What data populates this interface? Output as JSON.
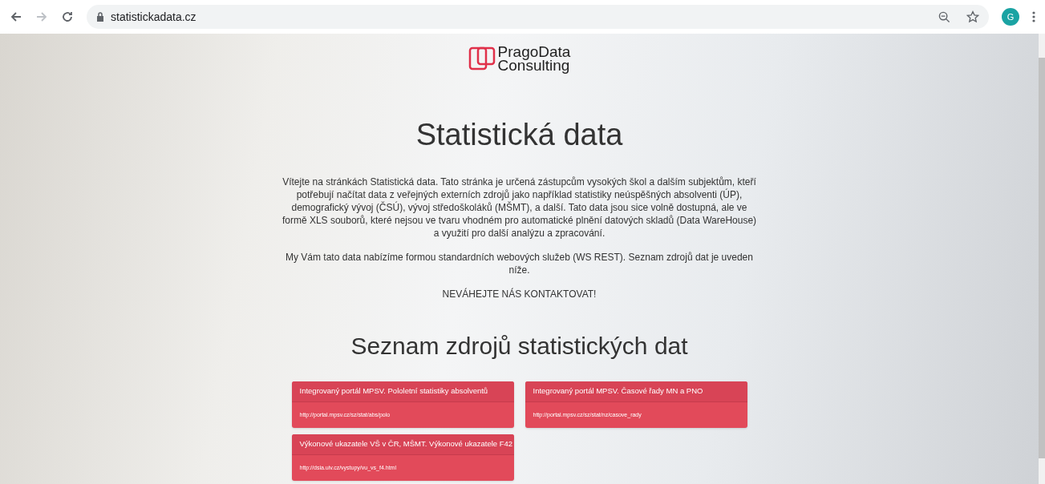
{
  "browser": {
    "url": "statistickadata.cz",
    "profile_initial": "G"
  },
  "logo": {
    "line1": "PragoData",
    "line2": "Consulting"
  },
  "title": "Statistická data",
  "paragraphs": [
    "Vítejte na stránkách Statistická data. Tato stránka je určená zástupcům vysokých škol a dalším subjektům, kteří potřebují načítat data z veřejných externích zdrojů jako například statistiky neúspěšných absolventi (ÚP), demografický vývoj (ČSÚ), vývoj středoškoláků (MŠMT), a další. Tato data jsou sice volně dostupná, ale ve formě XLS souborů, které nejsou ve tvaru vhodném pro automatické plnění datových skladů (Data WareHouse) a využití pro další analýzu a zpracování.",
    "My Vám tato data nabízíme formou standardních webových služeb (WS REST). Seznam zdrojů dat je uveden níže.",
    "NEVÁHEJTE NÁS KONTAKTOVAT!"
  ],
  "sources_heading": "Seznam zdrojů statistických dat",
  "sources": [
    {
      "title": "Integrovaný portál MPSV. Pololetní statistiky absolventů",
      "url": "http://portal.mpsv.cz/sz/stat/abs/polo"
    },
    {
      "title": "Integrovaný portál MPSV. Časové řady MN a PNO",
      "url": "http://portal.mpsv.cz/sz/stat/nz/casove_rady"
    },
    {
      "title": "Výkonové ukazatele VŠ v ČR, MŠMT. Výkonové ukazatele F42",
      "url": "http://dsia.uiv.cz/vystupy/vu_vs_f4.html"
    }
  ]
}
